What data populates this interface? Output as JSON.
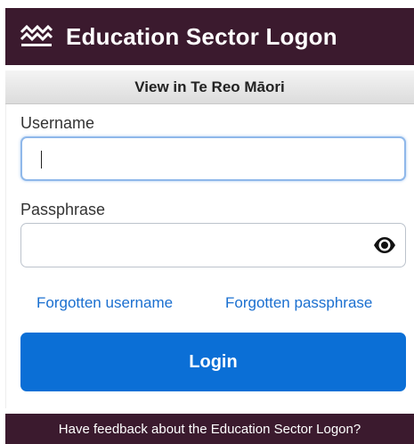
{
  "header": {
    "title": "Education Sector Logon",
    "logo_icon": "waves-logo-icon",
    "background": "#3b1a2e"
  },
  "language": {
    "toggle_label": "View in Te Reo Māori"
  },
  "form": {
    "username_label": "Username",
    "username_value": "",
    "passphrase_label": "Passphrase",
    "passphrase_value": "",
    "show_passphrase_icon": "eye-icon",
    "forgot_username_label": "Forgotten username",
    "forgot_passphrase_label": "Forgotten passphrase",
    "login_label": "Login",
    "accent_color": "#0b6fd6"
  },
  "footer": {
    "feedback_label": "Have feedback about the Education Sector Logon?"
  }
}
